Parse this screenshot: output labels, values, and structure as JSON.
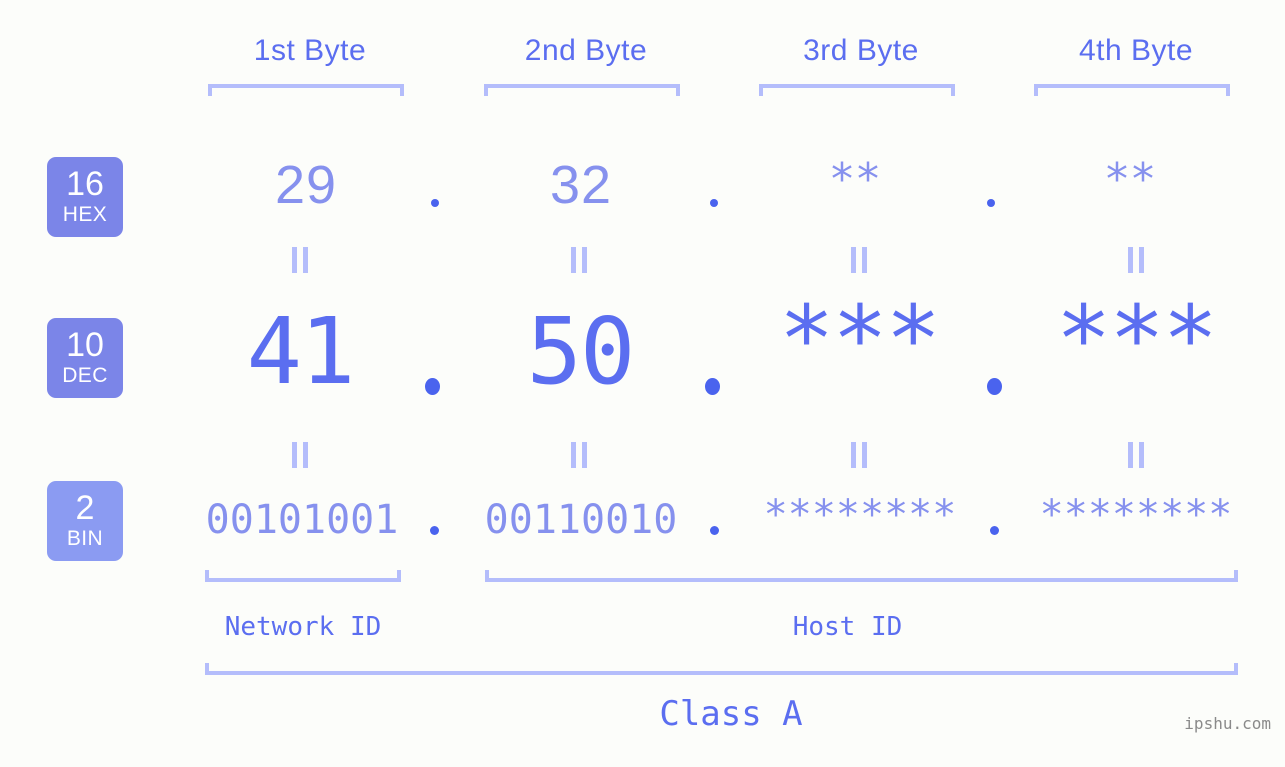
{
  "meta": {
    "background_color": "#fcfdfa",
    "accent_color": "#5b6ef0",
    "light_accent_color": "#8691ee",
    "bracket_color": "#b4bdfb",
    "badge_color": "#7b85e8",
    "badge_color_light": "#8b9bf2",
    "watermark": "ipshu.com"
  },
  "header": {
    "bytes": [
      {
        "label": "1st Byte"
      },
      {
        "label": "2nd Byte"
      },
      {
        "label": "3rd Byte"
      },
      {
        "label": "4th Byte"
      }
    ]
  },
  "rows": {
    "hex": {
      "badge_num": "16",
      "badge_radix": "HEX",
      "values": [
        "29",
        "32",
        "**",
        "**"
      ],
      "separator": "."
    },
    "dec": {
      "badge_num": "10",
      "badge_radix": "DEC",
      "values": [
        "41",
        "50",
        "***",
        "***"
      ],
      "separator": "."
    },
    "bin": {
      "badge_num": "2",
      "badge_radix": "BIN",
      "values": [
        "00101001",
        "00110010",
        "********",
        "********"
      ],
      "separator": "."
    }
  },
  "equality_marks": {
    "symbol": "=",
    "count_per_row": 4
  },
  "footer": {
    "network_id_label": "Network ID",
    "host_id_label": "Host ID",
    "class_label": "Class A"
  }
}
